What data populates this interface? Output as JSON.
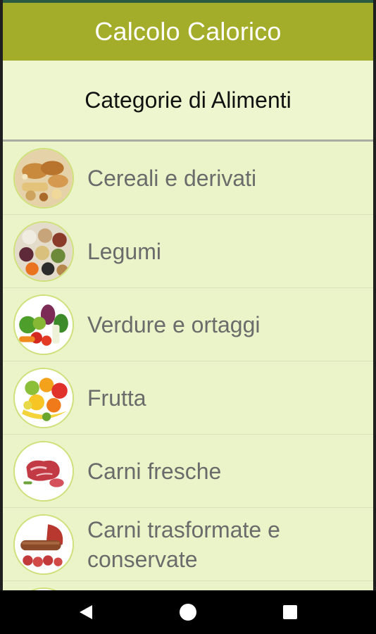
{
  "app": {
    "title": "Calcolo Calorico"
  },
  "header": {
    "title": "Categorie di Alimenti"
  },
  "categories": [
    {
      "label": "Cereali e derivati",
      "icon": "bread-grains-icon"
    },
    {
      "label": "Legumi",
      "icon": "beans-legumes-icon"
    },
    {
      "label": "Verdure e ortaggi",
      "icon": "vegetables-icon"
    },
    {
      "label": "Frutta",
      "icon": "fruit-icon"
    },
    {
      "label": "Carni fresche",
      "icon": "fresh-meat-icon"
    },
    {
      "label": "Carni trasformate e conservate",
      "icon": "cured-meat-icon"
    }
  ],
  "colors": {
    "appbar": "#a4ad2a",
    "background": "#e9f3c7",
    "thumb_border": "#cfe07a"
  },
  "navbar": {
    "icons": [
      "back-icon",
      "home-icon",
      "recent-apps-icon"
    ]
  }
}
